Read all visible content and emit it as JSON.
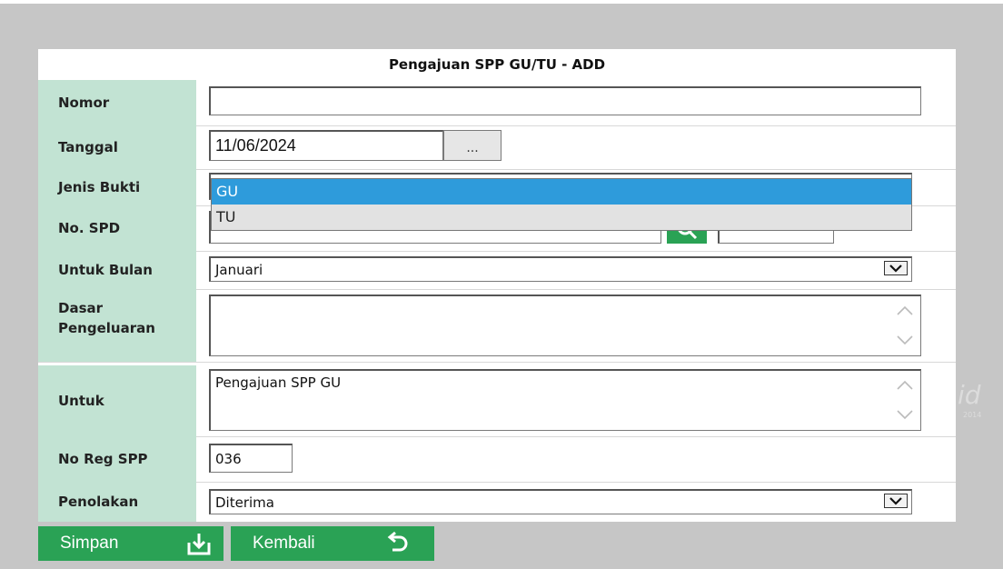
{
  "form": {
    "title": "Pengajuan SPP GU/TU - ADD",
    "fields": {
      "nomor": {
        "label": "Nomor",
        "value": ""
      },
      "tanggal": {
        "label": "Tanggal",
        "value": "11/06/2024",
        "picker_label": "..."
      },
      "jenis_bukti": {
        "label": "Jenis Bukti",
        "options": [
          "GU",
          "TU"
        ],
        "selected": "GU"
      },
      "no_spd": {
        "label": "No. SPD",
        "value": "",
        "value2": ""
      },
      "untuk_bulan": {
        "label": "Untuk Bulan",
        "value": "Januari"
      },
      "dasar_pengeluaran": {
        "label_line1": "Dasar",
        "label_line2": "Pengeluaran",
        "value": ""
      },
      "untuk": {
        "label": "Untuk",
        "value": "Pengajuan SPP GU"
      },
      "no_reg_spp": {
        "label": "No Reg SPP",
        "value": "036"
      },
      "penolakan": {
        "label": "Penolakan",
        "value": "Diterima"
      }
    }
  },
  "buttons": {
    "simpan": "Simpan",
    "kembali": "Kembali"
  },
  "watermark": {
    "text": "id",
    "year": "2014"
  },
  "colors": {
    "label_bg": "#c2e3d3",
    "button_green": "#2aa255",
    "dropdown_selected": "#2e9bdb",
    "background": "#c6c6c6"
  }
}
